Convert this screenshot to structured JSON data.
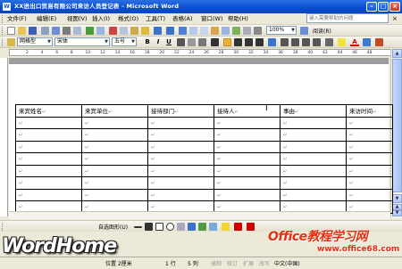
{
  "window": {
    "title": "XX进出口贸易有限公司来访人员登记表 - Microsoft Word",
    "app_icon": "W"
  },
  "menu": {
    "items": [
      "文件(F)",
      "编辑(E)",
      "视图(V)",
      "插入(I)",
      "格式(O)",
      "工具(T)",
      "表格(A)",
      "窗口(W)",
      "帮助(H)"
    ],
    "help_placeholder": "键入需要帮助的问题"
  },
  "standard_toolbar": {
    "zoom": "100%",
    "read_label": "阅读(R)"
  },
  "format_toolbar": {
    "style": "网格型",
    "font": "宋体",
    "size": "五号",
    "bold": "B",
    "italic": "I",
    "underline": "U",
    "font_color_letter": "A"
  },
  "ruler": {
    "ticks": [
      "2",
      "4",
      "6",
      "8",
      "10",
      "12",
      "14",
      "16",
      "18",
      "20",
      "22",
      "24",
      "26",
      "28",
      "30",
      "32",
      "34",
      "36",
      "38",
      "40",
      "42",
      "44",
      "46",
      "48"
    ]
  },
  "table": {
    "headers": [
      "来宾姓名",
      "来宾单位",
      "接待部门",
      "接待人",
      "事由",
      "来访时间"
    ],
    "cell_mark": "↵",
    "empty_rows": 8
  },
  "draw_toolbar": {
    "autoshape_label": "自选图形(U)"
  },
  "status": {
    "position": "位置 2厘米",
    "line": "1 行",
    "column": "5 列",
    "rec": "录制",
    "trk": "修订",
    "ext": "扩展",
    "ovr": "改写",
    "language": "中文(中国)"
  },
  "watermarks": {
    "left": "WordHome",
    "right": "Office教程学习网",
    "url": "www.office68.com"
  },
  "colors": {
    "title_blue": "#0a4fd0",
    "watermark_red": "#e23112"
  }
}
